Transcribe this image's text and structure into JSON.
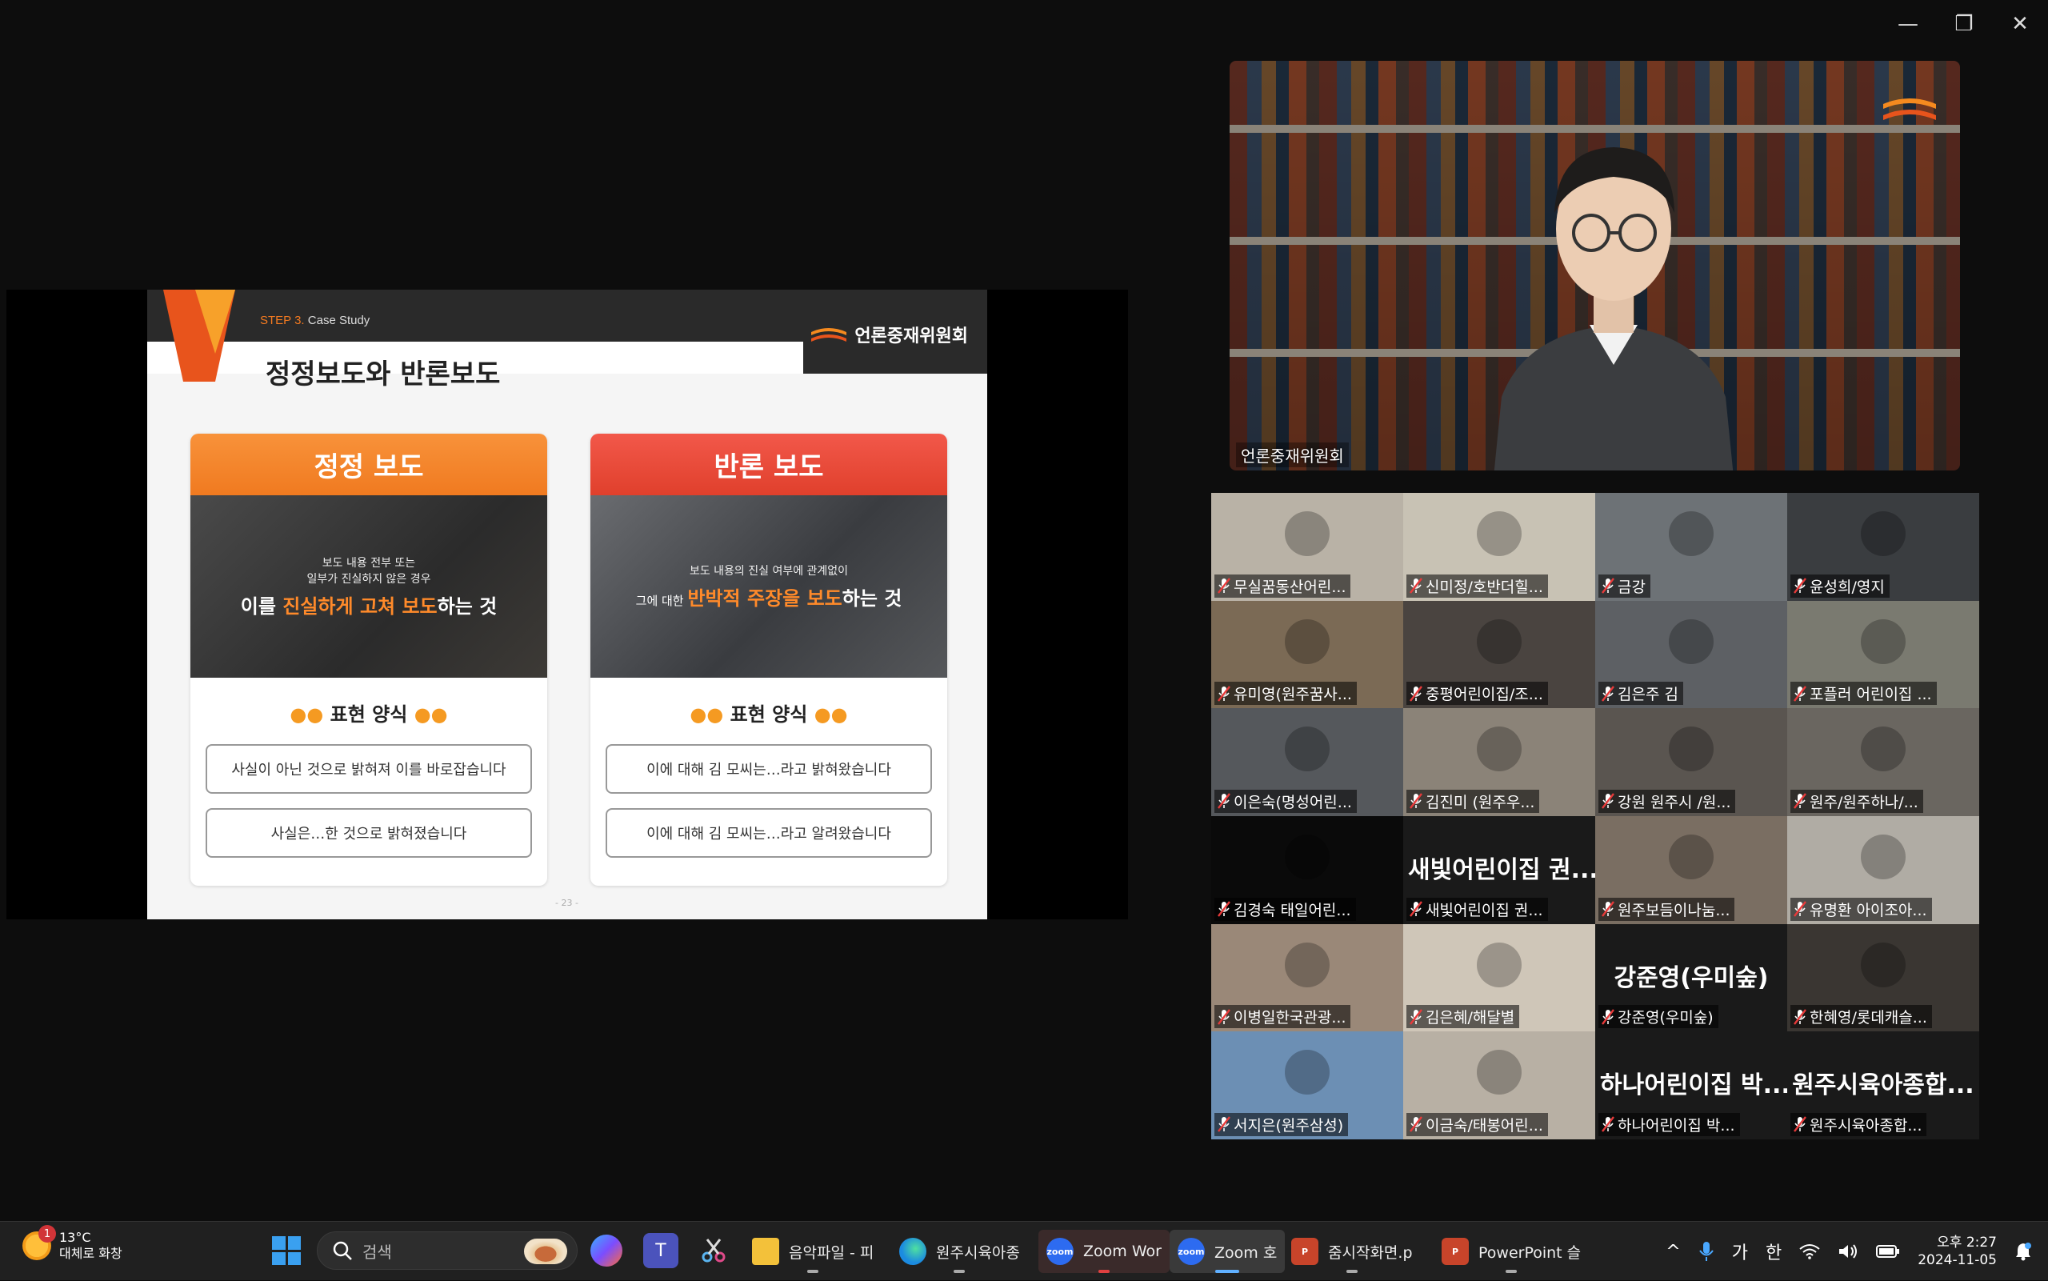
{
  "window": {
    "minimize_glyph": "—",
    "maximize_glyph": "❐",
    "close_glyph": "✕"
  },
  "slide": {
    "step_prefix": "STEP 3.",
    "step_text": "Case Study",
    "org_logo": "언론중재위원회",
    "title": "정정보도와 반론보도",
    "page": "- 23 -",
    "cards": [
      {
        "heading": "정정 보도",
        "small_line1": "보도 내용 전부 또는",
        "small_line2": "일부가 진실하지 않은 경우",
        "big_pre": "이를 ",
        "big_highlight": "진실하게 고쳐 보도",
        "big_post": "하는 것",
        "form_title": "표현 양식",
        "options": [
          "사실이 아닌 것으로 밝혀져 이를 바로잡습니다",
          "사실은…한 것으로 밝혀졌습니다"
        ]
      },
      {
        "heading": "반론 보도",
        "small_line1": "보도 내용의 진실 여부에 관계없이",
        "small_line2": "",
        "big_pre": "그에 대한 ",
        "big_highlight": "반박적 주장을 보도",
        "big_post": "하는 것",
        "form_title": "표현 양식",
        "options": [
          "이에 대해 김 모씨는…라고 밝혀왔습니다",
          "이에 대해 김 모씨는…라고 알려왔습니다"
        ]
      }
    ],
    "dots": "●●"
  },
  "speaker": {
    "label": "언론중재위원회"
  },
  "gallery": [
    {
      "name": "무실꿈동산어린...",
      "big": "",
      "bg": "#b9b2a6"
    },
    {
      "name": "신미정/호반더힐...",
      "big": "",
      "bg": "#c8c2b4"
    },
    {
      "name": "금강",
      "big": "",
      "bg": "#6d7276"
    },
    {
      "name": "윤성희/영지",
      "big": "",
      "bg": "#3a3d40"
    },
    {
      "name": "유미영(원주꿈사...",
      "big": "",
      "bg": "#7b6a55"
    },
    {
      "name": "중평어린이집/조...",
      "big": "",
      "bg": "#4a4440"
    },
    {
      "name": "김은주 김",
      "big": "",
      "bg": "#5d6064"
    },
    {
      "name": "포플러 어린이집 ...",
      "big": "",
      "bg": "#7a7a70"
    },
    {
      "name": "이은숙(명성어린...",
      "big": "",
      "bg": "#55585c"
    },
    {
      "name": "김진미 (원주우...",
      "big": "",
      "bg": "#8b8378"
    },
    {
      "name": "강원 원주시 /원...",
      "big": "",
      "bg": "#5a5550"
    },
    {
      "name": "원주/원주하나/...",
      "big": "",
      "bg": "#6a6660"
    },
    {
      "name": "김경숙 태일어린...",
      "big": "",
      "bg": "#0a0a0a"
    },
    {
      "name": "새빛어린이집 권...",
      "big": "새빛어린이집 권...",
      "bg": "#1a1a1a"
    },
    {
      "name": "원주보듬이나눔...",
      "big": "",
      "bg": "#7a6e62"
    },
    {
      "name": "유명환 아이조아...",
      "big": "",
      "bg": "#b0aca4"
    },
    {
      "name": "이병일한국관광...",
      "big": "",
      "bg": "#9a8878"
    },
    {
      "name": "김은혜/해달별",
      "big": "",
      "bg": "#cfc6b8"
    },
    {
      "name": "강준영(우미숲)",
      "big": "강준영(우미숲)",
      "bg": "#1a1a1a"
    },
    {
      "name": "한혜영/롯데캐슬...",
      "big": "",
      "bg": "#3a3632"
    },
    {
      "name": "서지은(원주삼성)",
      "big": "",
      "bg": "#6c8fb4"
    },
    {
      "name": "이금숙/태봉어린...",
      "big": "",
      "bg": "#b8b0a4"
    },
    {
      "name": "하나어린이집 박...",
      "big": "하나어린이집 박...",
      "bg": "#1a1a1a"
    },
    {
      "name": "원주시육아종합...",
      "big": "원주시육아종합...",
      "bg": "#1a1a1a"
    }
  ],
  "taskbar": {
    "weather_temp": "13°C",
    "weather_desc": "대체로 화창",
    "weather_badge": "1",
    "search_placeholder": "검색",
    "apps": [
      {
        "label": "음악파일 - 피",
        "color": "#f3c13a"
      },
      {
        "label": "원주시육아종",
        "color": "#1b8be0"
      },
      {
        "label": "Zoom Wor",
        "color": "#2d6bf0"
      },
      {
        "label": "Zoom 호",
        "color": "#2d6bf0"
      },
      {
        "label": "줌시작화면.p",
        "color": "#c8442a"
      },
      {
        "label": "PowerPoint 슬",
        "color": "#c8442a"
      }
    ],
    "zoom_icon_text": "zoom",
    "ppt_icon_text": "P",
    "tray": {
      "chevron": "^",
      "ime1": "가",
      "ime2": "한",
      "time": "오후 2:27",
      "date": "2024-11-05"
    }
  }
}
